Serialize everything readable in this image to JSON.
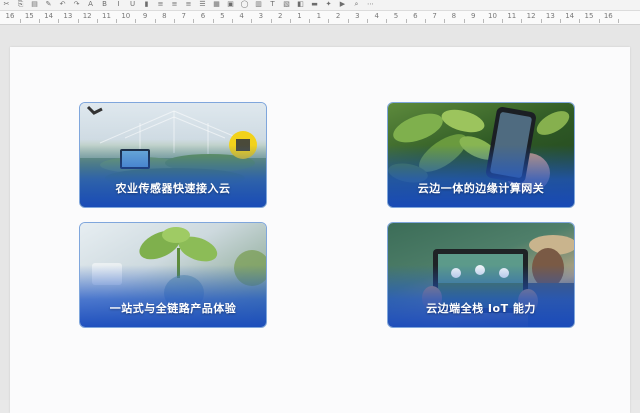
{
  "ruler": {
    "numbers": [
      "16",
      "15",
      "14",
      "13",
      "12",
      "11",
      "10",
      "9",
      "8",
      "7",
      "6",
      "5",
      "4",
      "3",
      "2",
      "1",
      "1",
      "2",
      "3",
      "4",
      "5",
      "6",
      "7",
      "8",
      "9",
      "10",
      "11",
      "12",
      "13",
      "14",
      "15",
      "16"
    ]
  },
  "cards": [
    {
      "label": "农业传感器快速接入云"
    },
    {
      "label": "云边一体的边缘计算网关"
    },
    {
      "label": "一站式与全链路产品体验"
    },
    {
      "label": "云边端全栈 IoT 能力"
    }
  ],
  "colors": {
    "card_border": "#7fa6dc",
    "card_overlay": "#1f56c7",
    "slide_background": "#fbfbfc"
  }
}
